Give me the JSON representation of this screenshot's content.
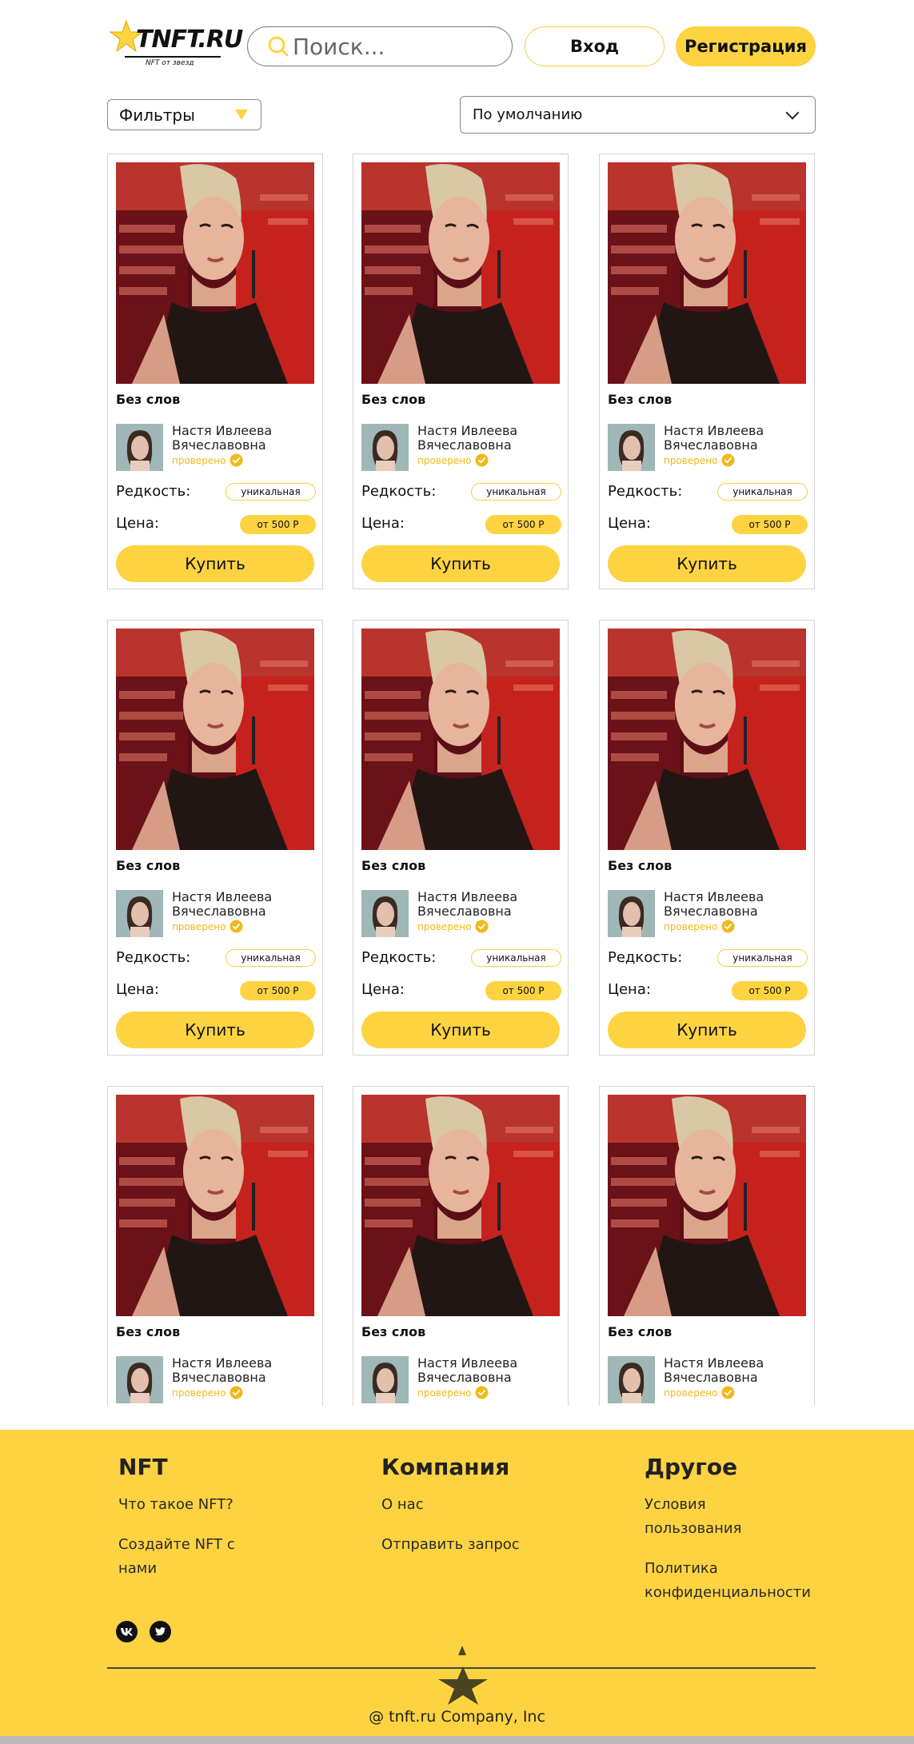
{
  "header": {
    "logo_text": "TNFT.RU",
    "logo_subtitle": "NFT от звезд",
    "search_placeholder": "Поиск...",
    "login_label": "Вход",
    "register_label": "Регистрация"
  },
  "toolbar": {
    "filters_label": "Фильтры",
    "sort_selected": "По умолчанию"
  },
  "card_template": {
    "title": "Без слов",
    "author_line1": "Настя Ивлеева",
    "author_line2": "Вячеславовна",
    "verified_label": "проверено",
    "rarity_label": "Редкость:",
    "rarity_value": "уникальная",
    "price_label": "Цена:",
    "price_value": "от 500 Р",
    "buy_label": "Купить"
  },
  "cards": [
    {
      "title": "Без слов",
      "author": "Настя Ивлеева Вячеславовна"
    },
    {
      "title": "Без слов",
      "author": "Настя Ивлеева Вячеславовна"
    },
    {
      "title": "Без слов",
      "author": "Настя Ивлеева Вячеславовна"
    },
    {
      "title": "Без слов",
      "author": "Настя Ивлеева Вячеславовна"
    },
    {
      "title": "Без слов",
      "author": "Настя Ивлеева Вячеславовна"
    },
    {
      "title": "Без слов",
      "author": "Настя Ивлеева Вячеславовна"
    },
    {
      "title": "Без слов",
      "author": "Настя Ивлеева Вячеславовна"
    },
    {
      "title": "Без слов",
      "author": "Настя Ивлеева Вячеславовна"
    },
    {
      "title": "Без слов",
      "author": "Настя Ивлеева Вячеславовна"
    }
  ],
  "footer": {
    "col1": {
      "heading": "NFT",
      "links": [
        "Что такое NFT?",
        "Создайте NFT с нами"
      ]
    },
    "col2": {
      "heading": "Компания",
      "links": [
        "О нас",
        "Отправить запрос"
      ]
    },
    "col3": {
      "heading": "Другое",
      "links": [
        "Условия пользования",
        "Политика конфиденциальности"
      ]
    },
    "social": [
      "vk-icon",
      "twitter-icon"
    ],
    "copyright": "@ tnft.ru Company, Inc"
  },
  "colors": {
    "accent": "#fdd341",
    "verified": "#f0b91a",
    "border": "#d2d2d2"
  }
}
